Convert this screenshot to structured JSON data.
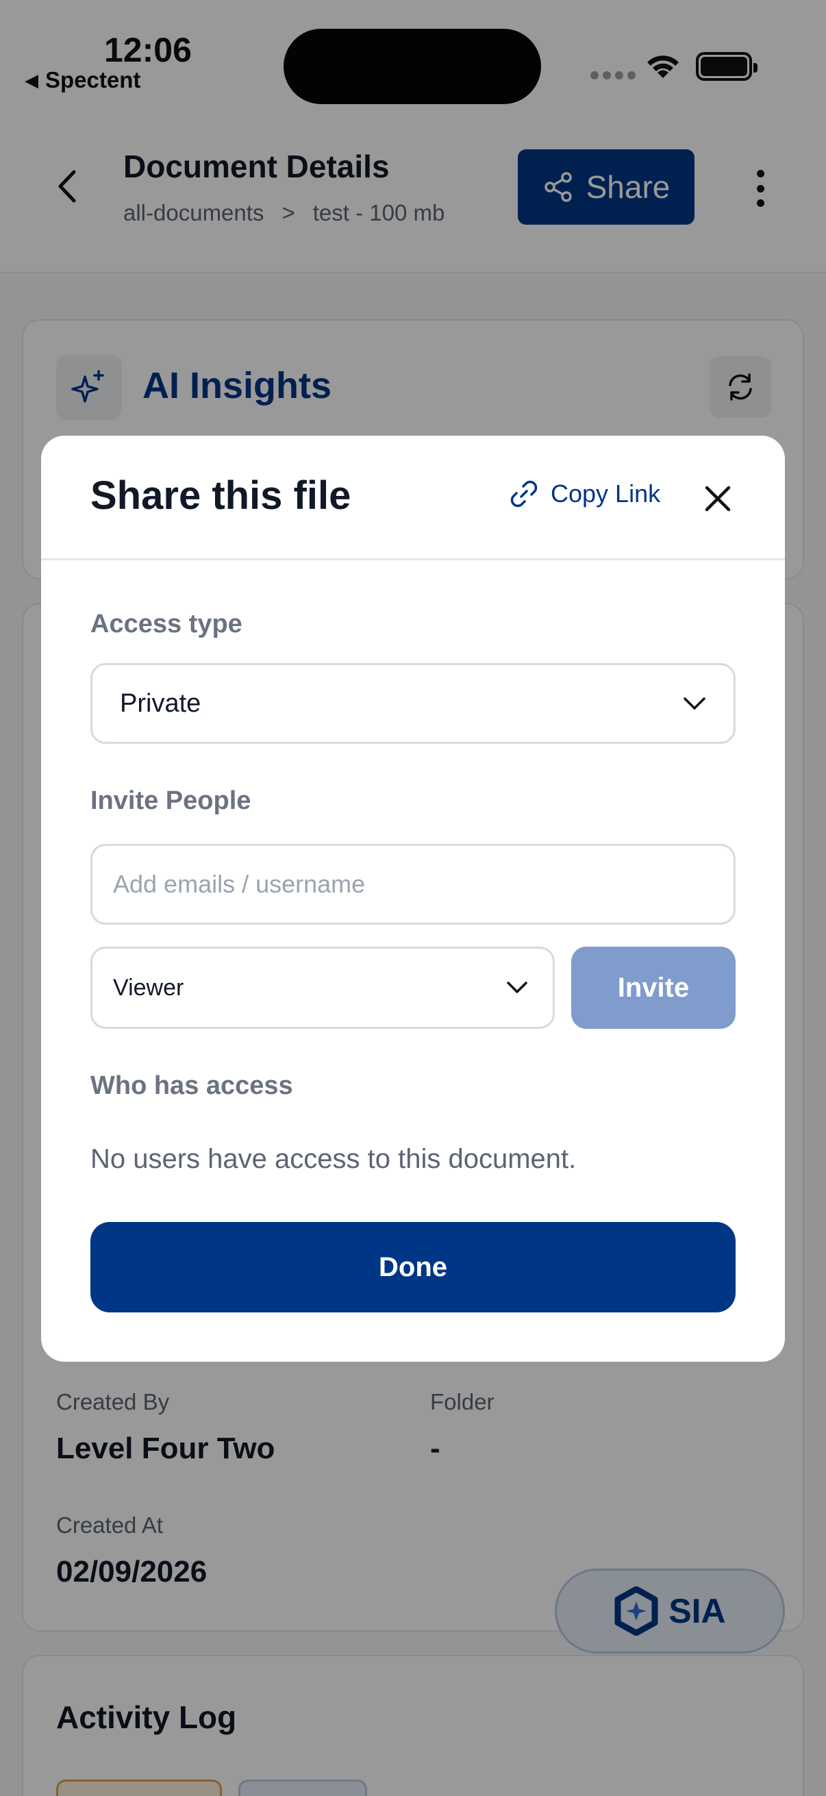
{
  "status_bar": {
    "time": "12:06",
    "back_app": "Spectent"
  },
  "header": {
    "title": "Document Details",
    "breadcrumb": [
      "all-documents",
      ">",
      "test - 100 mb"
    ],
    "share_label": "Share"
  },
  "ai_insights": {
    "title": "AI Insights"
  },
  "details": {
    "created_by_label": "Created By",
    "created_by_value": "Level Four Two",
    "folder_label": "Folder",
    "folder_value": "-",
    "created_at_label": "Created At",
    "created_at_value": "02/09/2026"
  },
  "activity": {
    "title": "Activity Log"
  },
  "sia": {
    "label": "SIA"
  },
  "modal": {
    "title": "Share this file",
    "copy_link": "Copy Link",
    "access_type_label": "Access type",
    "access_type_value": "Private",
    "invite_label": "Invite People",
    "email_placeholder": "Add emails / username",
    "role_value": "Viewer",
    "invite_button": "Invite",
    "who_has_access_label": "Who has access",
    "no_users_text": "No users have access to this document.",
    "done_button": "Done"
  },
  "colors": {
    "primary": "#003686",
    "primary_disabled": "#7f9ccc",
    "overlay": "rgba(0,0,0,0.40)"
  }
}
